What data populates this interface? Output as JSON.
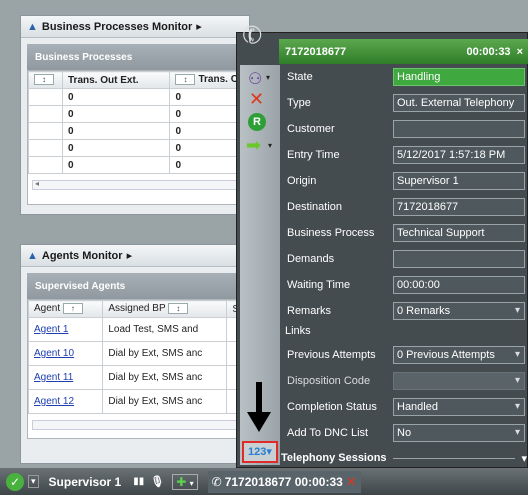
{
  "bpm": {
    "title": "Business Processes Monitor",
    "section": "Business Processes",
    "col1": "Trans. Out Ext.",
    "col2": "Trans. O",
    "rows": [
      [
        "0",
        "0"
      ],
      [
        "0",
        "0"
      ],
      [
        "0",
        "0"
      ],
      [
        "0",
        "0"
      ],
      [
        "0",
        "0"
      ]
    ]
  },
  "agm": {
    "title": "Agents Monitor",
    "section": "Supervised Agents",
    "cols": [
      "Agent",
      "Assigned BP",
      "State"
    ],
    "rows": [
      [
        "Agent 1",
        "Load Test, SMS and"
      ],
      [
        "Agent 10",
        "Dial by Ext, SMS anc"
      ],
      [
        "Agent 11",
        "Dial by Ext, SMS anc"
      ],
      [
        "Agent 12",
        "Dial by Ext, SMS anc"
      ]
    ]
  },
  "call": {
    "number": "7172018677",
    "timer": "00:00:33",
    "fields": [
      {
        "label": "State",
        "value": "Handling"
      },
      {
        "label": "Type",
        "value": "Out. External Telephony"
      },
      {
        "label": "Customer",
        "value": ""
      },
      {
        "label": "Entry Time",
        "value": "5/12/2017 1:57:18 PM"
      },
      {
        "label": "Origin",
        "value": "Supervisor 1"
      },
      {
        "label": "Destination",
        "value": "7172018677"
      },
      {
        "label": "Business Process",
        "value": "Technical Support"
      },
      {
        "label": "Demands",
        "value": ""
      },
      {
        "label": "Waiting Time",
        "value": "00:00:00"
      },
      {
        "label": "Remarks",
        "value": "0 Remarks"
      }
    ],
    "links_label": "Links",
    "link_fields": [
      {
        "label": "Previous Attempts",
        "value": "0 Previous Attempts"
      },
      {
        "label": "Disposition Code",
        "value": ""
      },
      {
        "label": "Completion Status",
        "value": "Handled"
      },
      {
        "label": "Add To DNC List",
        "value": "No"
      }
    ],
    "sessions": "Telephony Sessions",
    "keypad": "123"
  },
  "taskbar": {
    "user": "Supervisor 1",
    "call": "7172018677 00:00:33"
  }
}
